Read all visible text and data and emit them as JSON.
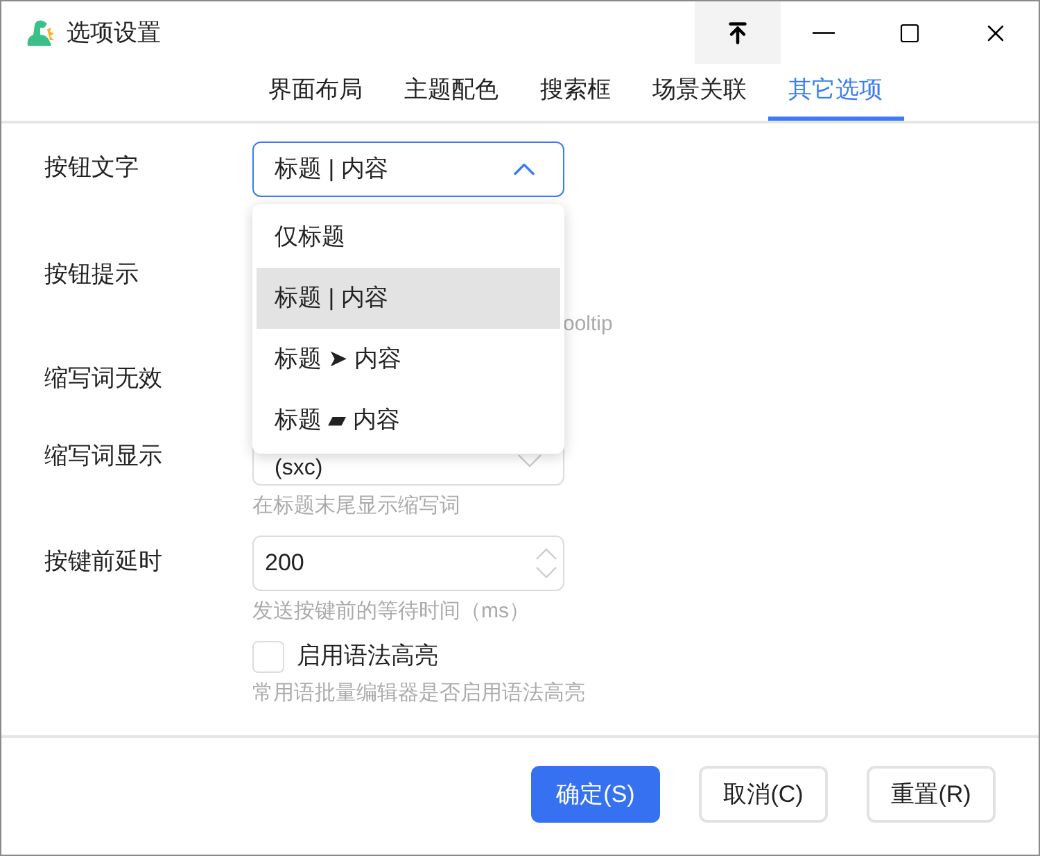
{
  "window": {
    "title": "选项设置"
  },
  "tabs": [
    {
      "label": "界面布局",
      "selected": false
    },
    {
      "label": "主题配色",
      "selected": false
    },
    {
      "label": "搜索框",
      "selected": false
    },
    {
      "label": "场景关联",
      "selected": false
    },
    {
      "label": "其它选项",
      "selected": true
    }
  ],
  "settings": [
    {
      "kind": "select",
      "label": "按钮文字",
      "value": "标题 | 内容",
      "expanded": true
    },
    {
      "kind": "hidden",
      "label": "按钮提示",
      "hint": "ooltip"
    },
    {
      "kind": "hidden",
      "label": "缩写词无效"
    },
    {
      "kind": "select",
      "label": "缩写词显示",
      "value": "(sxc)",
      "expanded": false,
      "hint": "在标题末尾显示缩写词"
    },
    {
      "kind": "number",
      "label": "按键前延时",
      "value": "200",
      "hint": "发送按键前的等待时间（ms）"
    },
    {
      "kind": "checkbox",
      "label": "启用语法高亮",
      "checked": false,
      "hint": "常用语批量编辑器是否启用语法高亮"
    }
  ],
  "dropdown": {
    "options": [
      {
        "label": "仅标题",
        "selected": false
      },
      {
        "label": "标题 | 内容",
        "selected": true
      },
      {
        "label": "标题 ➤ 内容",
        "selected": false
      },
      {
        "label": "标题 ▰ 内容",
        "selected": false
      }
    ]
  },
  "buttons": [
    {
      "label": "确定(S)",
      "kind": "primary"
    },
    {
      "label": "取消(C)",
      "kind": "default"
    },
    {
      "label": "重置(R)",
      "kind": "default"
    }
  ]
}
